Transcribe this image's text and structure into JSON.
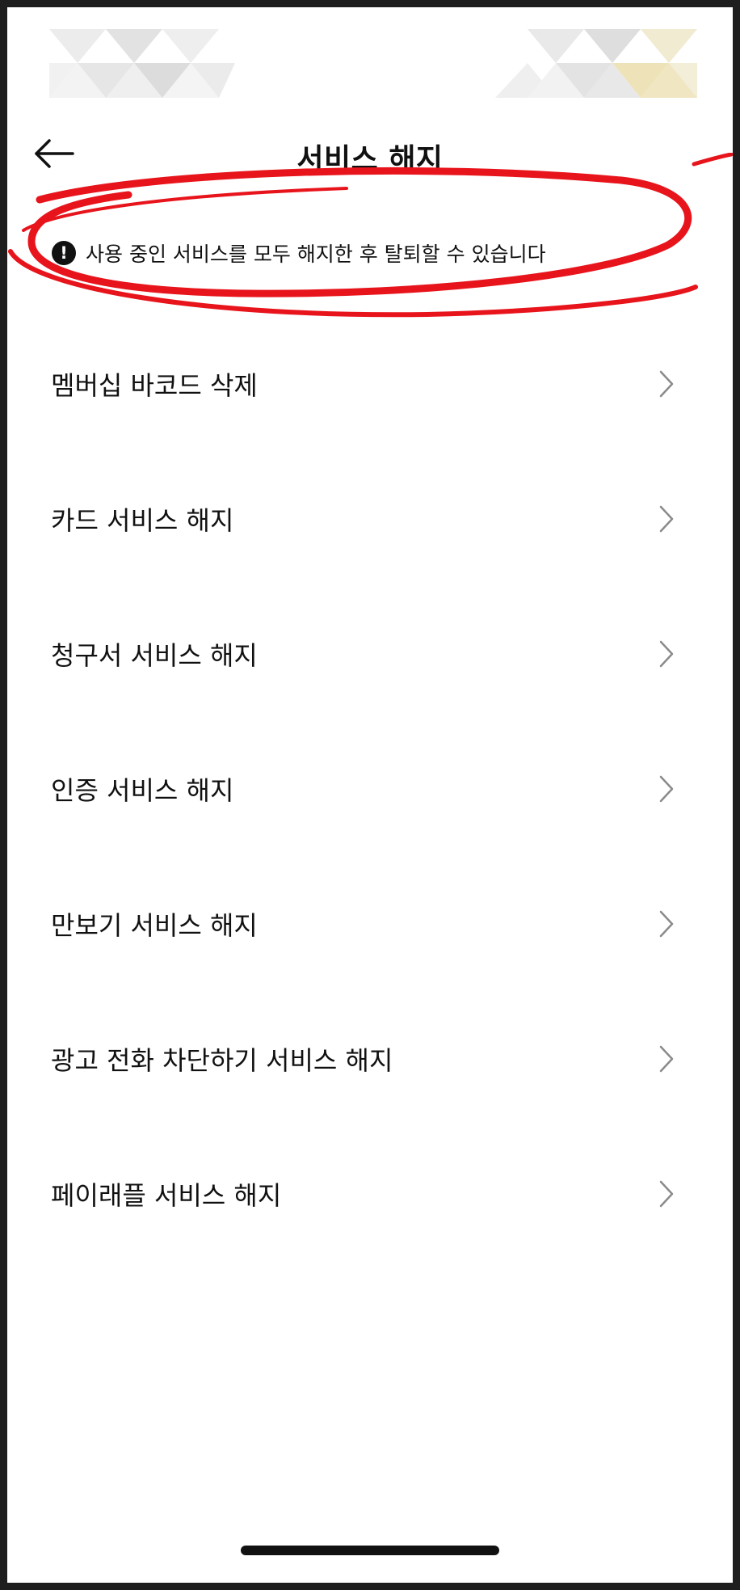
{
  "header": {
    "title": "서비스 해지",
    "back_icon": "arrow-left-icon"
  },
  "notice": {
    "icon": "exclamation-circle-icon",
    "icon_glyph": "!",
    "text": "사용 중인 서비스를 모두 해지한 후 탈퇴할 수 있습니다",
    "highlight_color": "#e8141c"
  },
  "menu": {
    "items": [
      {
        "label": "멤버십 바코드 삭제"
      },
      {
        "label": "카드 서비스 해지"
      },
      {
        "label": "청구서 서비스 해지"
      },
      {
        "label": "인증 서비스 해지"
      },
      {
        "label": "만보기 서비스 해지"
      },
      {
        "label": "광고 전화 차단하기 서비스 해지"
      },
      {
        "label": "페이래플 서비스 해지"
      }
    ],
    "chevron_icon": "chevron-right-icon"
  },
  "colors": {
    "text": "#111111",
    "background": "#ffffff",
    "frame": "#1e1e1e",
    "chevron": "#8a8a8a"
  }
}
